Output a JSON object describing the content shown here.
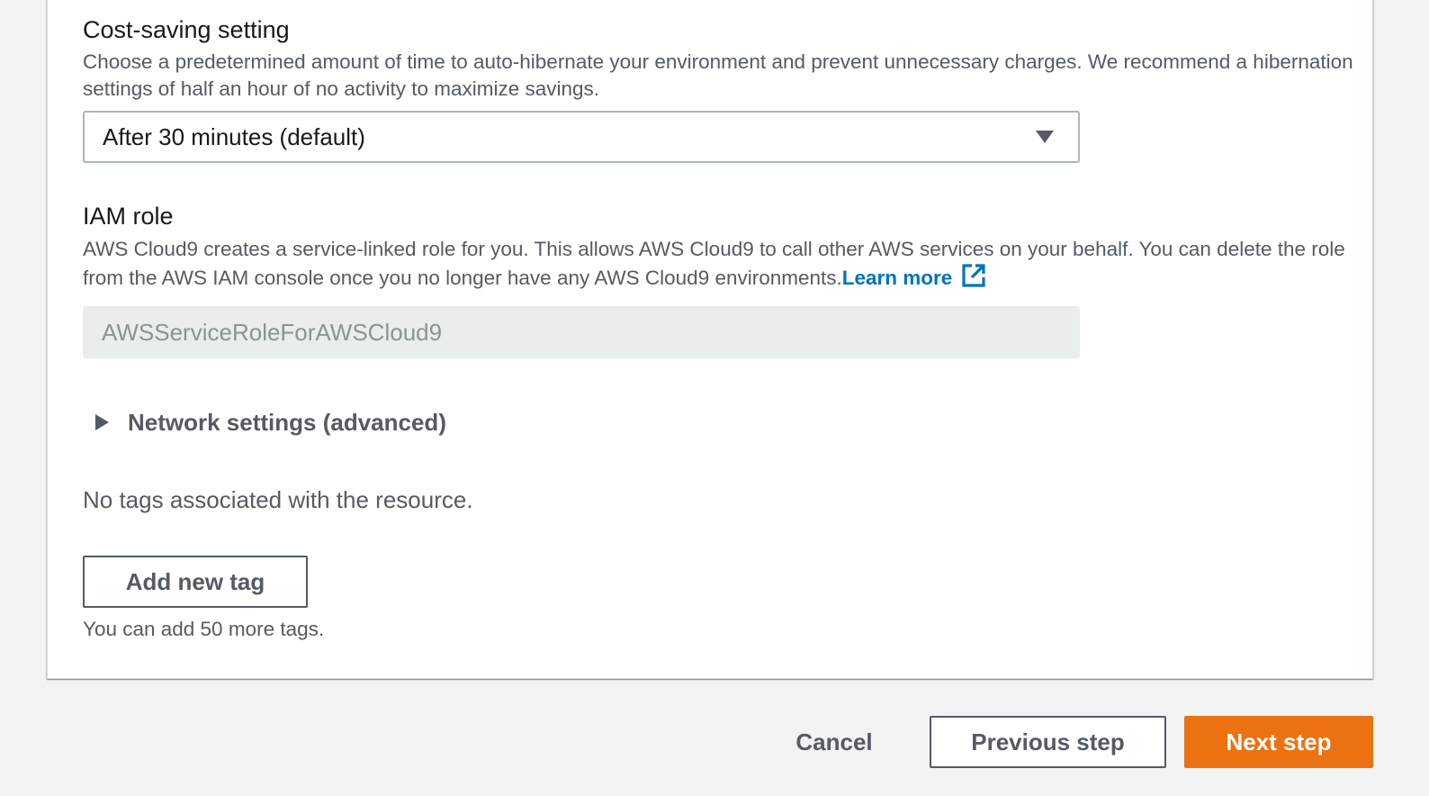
{
  "cost_saving": {
    "label": "Cost-saving setting",
    "description": "Choose a predetermined amount of time to auto-hibernate your environment and prevent unnecessary charges. We recommend a hibernation settings of half an hour of no activity to maximize savings.",
    "selected_value": "After 30 minutes (default)",
    "dropdown_icon": "caret-down-icon"
  },
  "iam_role": {
    "label": "IAM role",
    "description": "AWS Cloud9 creates a service-linked role for you. This allows AWS Cloud9 to call other AWS services on your behalf. You can delete the role from the AWS IAM console once you no longer have any AWS Cloud9 environments.",
    "learn_more": "Learn more",
    "learn_more_icon": "external-link-icon",
    "value": "AWSServiceRoleForAWSCloud9"
  },
  "network": {
    "label": "Network settings (advanced)",
    "icon": "caret-right-icon"
  },
  "tags": {
    "empty_text": "No tags associated with the resource.",
    "add_button": "Add new tag",
    "limit_text": "You can add 50 more tags."
  },
  "footer": {
    "cancel": "Cancel",
    "previous": "Previous step",
    "next": "Next step"
  },
  "colors": {
    "link": "#0073bb",
    "primary": "#ec7211",
    "background": "#f2f3f3"
  }
}
